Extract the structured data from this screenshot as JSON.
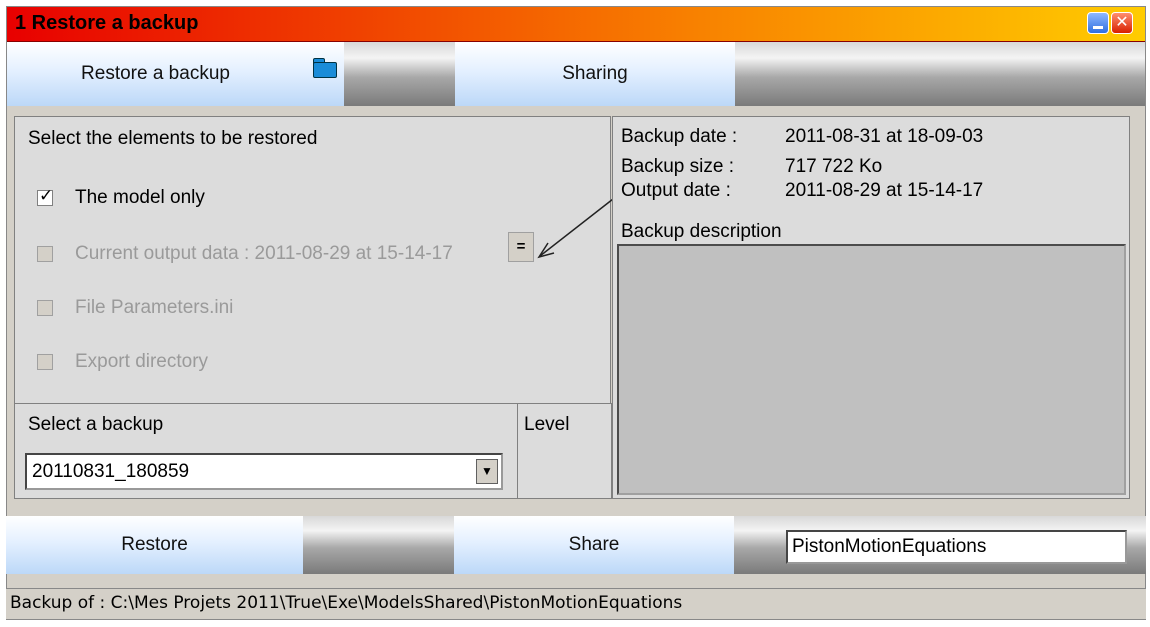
{
  "window": {
    "title": "1  Restore a backup"
  },
  "toolbar": {
    "restore_tab": "Restore a backup",
    "folder_icon": "folder-icon",
    "sharing_tab": "Sharing"
  },
  "elements": {
    "header": "Select the elements to be restored",
    "items": [
      {
        "label": "The model only",
        "checked": true,
        "enabled": true
      },
      {
        "label": "Current output data : 2011-08-29 at 15-14-17",
        "checked": false,
        "enabled": false
      },
      {
        "label": "File Parameters.ini",
        "checked": false,
        "enabled": false
      },
      {
        "label": "Export directory",
        "checked": false,
        "enabled": false
      }
    ],
    "equals_button": "="
  },
  "info": {
    "backup_date_label": "Backup date :",
    "backup_date_value": "2011-08-31 at 18-09-03",
    "backup_size_label": "Backup size :",
    "backup_size_value": "717 722 Ko",
    "output_date_label": "Output date :",
    "output_date_value": "2011-08-29 at 15-14-17",
    "description_label": "Backup description"
  },
  "select_backup": {
    "label": "Select a backup",
    "value": "20110831_180859",
    "level_label": "Level"
  },
  "actions": {
    "restore": "Restore",
    "share": "Share",
    "name_value": "PistonMotionEquations"
  },
  "status": {
    "text": "Backup of : C:\\Mes Projets 2011\\True\\Exe\\ModelsShared\\PistonMotionEquations"
  }
}
